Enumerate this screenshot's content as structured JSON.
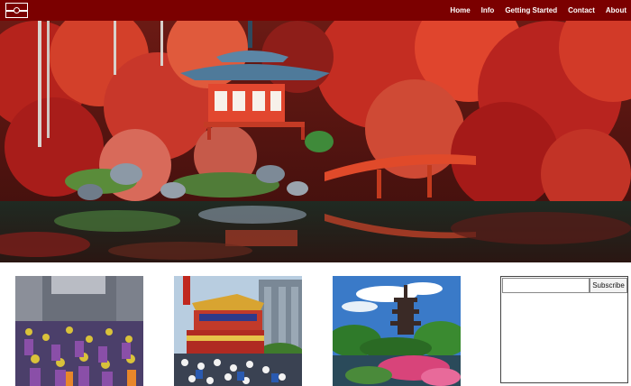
{
  "header": {
    "logo_icon": "flag-logo-icon",
    "nav": [
      {
        "label": "Home"
      },
      {
        "label": "Info"
      },
      {
        "label": "Getting Started"
      },
      {
        "label": "Contact"
      },
      {
        "label": "About"
      }
    ]
  },
  "hero": {
    "slides_total": 3,
    "active_slide": 1
  },
  "gallery": {
    "items": [
      {
        "subject": "festival-parade-photo"
      },
      {
        "subject": "festival-float-photo"
      },
      {
        "subject": "pagoda-garden-photo"
      }
    ]
  },
  "subscribe": {
    "placeholder": "",
    "button_label": "Subscribe"
  },
  "colors": {
    "brand": "#7b0000",
    "nav_text": "#ffffff"
  }
}
